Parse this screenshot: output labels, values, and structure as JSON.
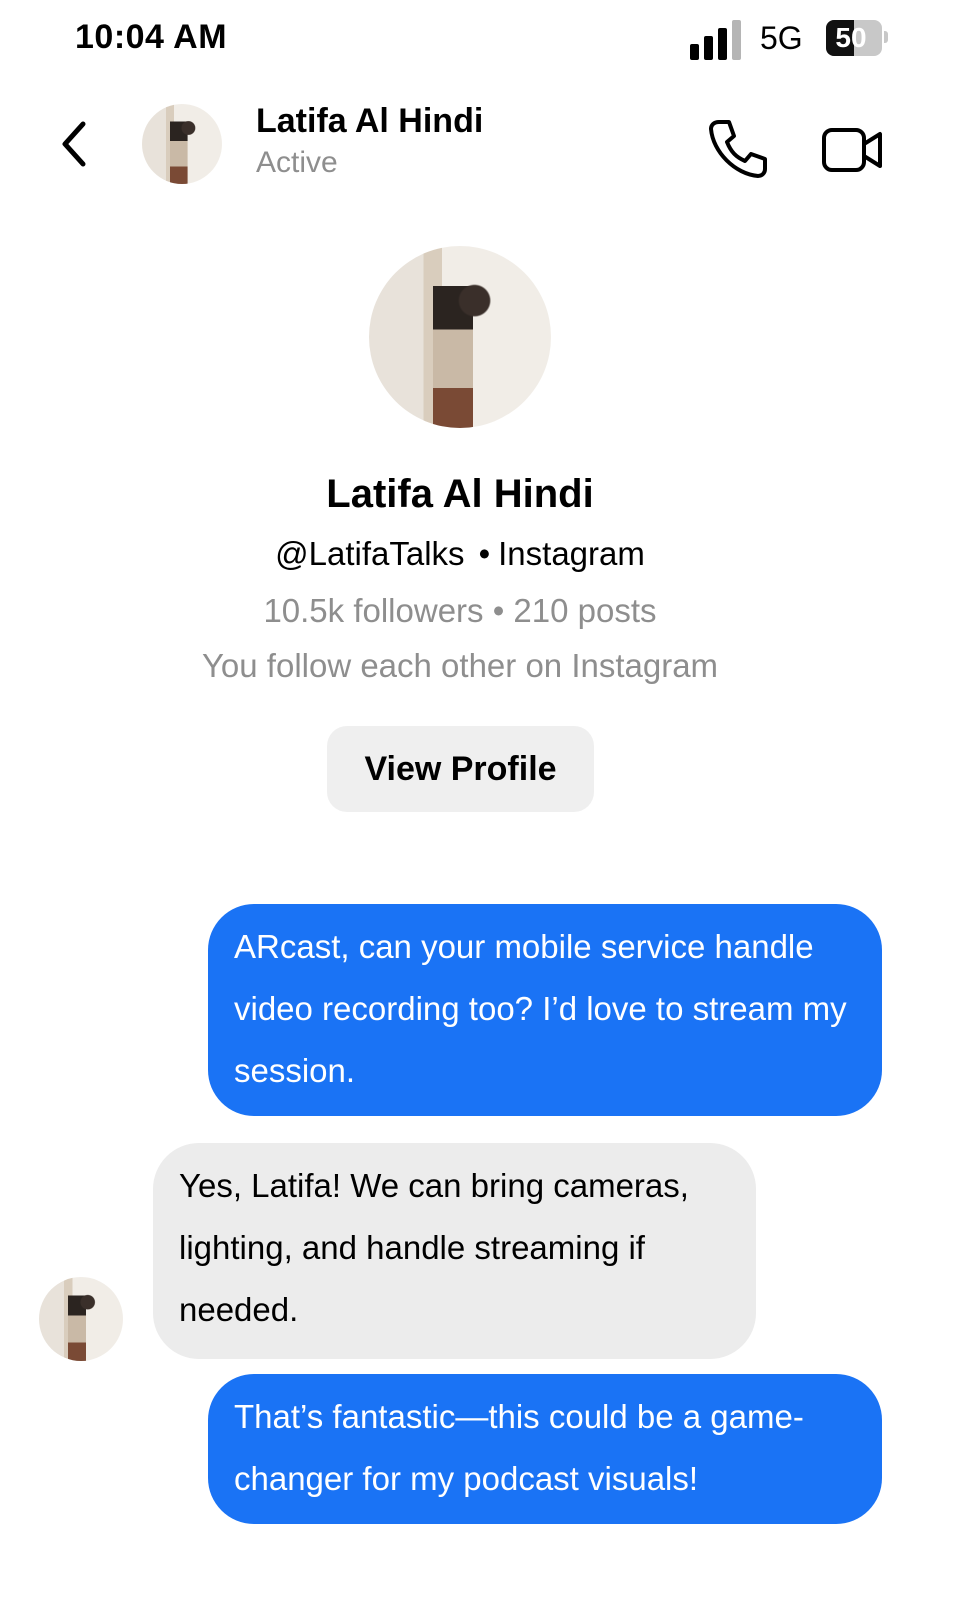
{
  "status_bar": {
    "time": "10:04 AM",
    "network": "5G",
    "battery": "50",
    "battery_level": 0.5,
    "signal_bars": 4
  },
  "header": {
    "back_icon": "chevron-left-icon",
    "name": "Latifa Al Hindi",
    "status": "Active",
    "call_icon": "phone-icon",
    "video_icon": "video-camera-icon"
  },
  "profile": {
    "name": "Latifa Al Hindi",
    "handle": "@LatifaTalks",
    "separator": "•",
    "platform": "Instagram",
    "stats": "10.5k followers • 210 posts",
    "follow_note": "You follow each other on Instagram",
    "view_profile_label": "View Profile"
  },
  "messages": [
    {
      "direction": "outgoing",
      "text": "ARcast, can your mobile service handle video recording too? I’d love to stream my session."
    },
    {
      "direction": "incoming",
      "text": "Yes, Latifa! We can bring cameras, lighting, and handle streaming if needed."
    },
    {
      "direction": "outgoing",
      "text": "That’s fantastic—this could be a game-changer for my podcast visuals!"
    }
  ],
  "colors": {
    "outgoing_bubble": "#1a73f5",
    "incoming_bubble": "#ececec",
    "secondary_text": "#8e8e8e",
    "button_bg": "#efefef"
  }
}
